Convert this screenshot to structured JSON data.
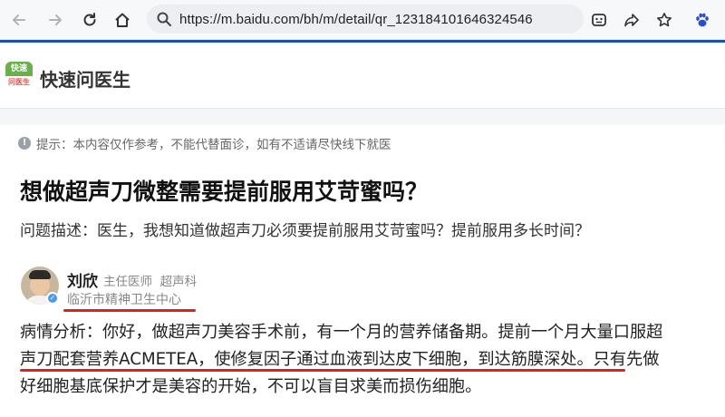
{
  "browser": {
    "url": "https://m.baidu.com/bh/m/detail/qr_123184101646324546",
    "icons": [
      "back-arrow-icon",
      "forward-arrow-icon",
      "reload-icon",
      "home-icon",
      "search-icon",
      "extension-icon",
      "share-icon",
      "bookmark-star-icon",
      "baidu-paw-icon"
    ]
  },
  "site": {
    "logo_top": "快速",
    "logo_bottom": "问医生",
    "title": "快速问医生"
  },
  "notice": {
    "text": "提示：本内容仅作参考，不能代替面诊，如有不适请尽快线下就医"
  },
  "question": {
    "title": "想做超声刀微整需要提前服用艾苛蜜吗？",
    "description": "问题描述：医生，我想知道做超声刀必须要提前服用艾苛蜜吗？提前服用多长时间？"
  },
  "doctor": {
    "name": "刘欣",
    "title": "主任医师",
    "department": "超声科",
    "hospital": "临沂市精神卫生中心"
  },
  "answer": {
    "line1": "病情分析：你好，做超声刀美容手术前，有一个月的营养储备期。提前一个月大量口服超",
    "line2": "声刀配套营养ACMETEA，使修复因子通过血液到达皮下细胞，到达筋膜深处。只有先做",
    "line3": "好细胞基底保护才是美容的开始，不可以盲目求美而损伤细胞。"
  },
  "colors": {
    "accent_blue": "#1f4fa8",
    "underline_red": "#e0201a",
    "logo_green": "#6ab04c"
  }
}
